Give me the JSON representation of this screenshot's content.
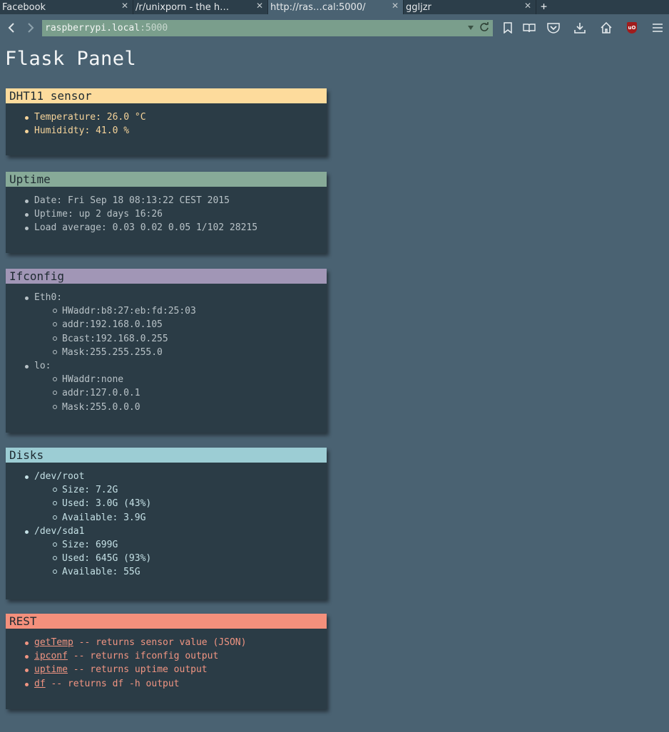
{
  "browser": {
    "tabs": [
      {
        "label": "Facebook",
        "active": false
      },
      {
        "label": "/r/unixporn - the h…",
        "active": false
      },
      {
        "label": "http://ras…cal:5000/",
        "active": true
      },
      {
        "label": "ggljzr",
        "active": false
      }
    ],
    "new_tab": "+",
    "url_host": "raspberrypi.local",
    "url_port": ":5000",
    "icons": [
      "back-icon",
      "forward-icon",
      "dropdown-icon",
      "reload-icon",
      "bookmark-icon",
      "reading-list-icon",
      "pocket-icon",
      "download-icon",
      "home-icon",
      "ublock-icon",
      "menu-icon"
    ],
    "ublock_label": "uO"
  },
  "page": {
    "title": "Flask Panel"
  },
  "panels": {
    "dht": {
      "title": "DHT11 sensor",
      "items": [
        "Temperature: 26.0 °C",
        "Humididty: 41.0 %"
      ]
    },
    "uptime": {
      "title": "Uptime",
      "items": [
        "Date: Fri Sep 18 08:13:22 CEST 2015",
        "Uptime: up 2 days 16:26",
        "Load average: 0.03 0.02 0.05 1/102 28215"
      ]
    },
    "ifconfig": {
      "title": "Ifconfig",
      "eth0": {
        "label": "Eth0:",
        "items": [
          "HWaddr:b8:27:eb:fd:25:03",
          "addr:192.168.0.105",
          "Bcast:192.168.0.255",
          "Mask:255.255.255.0"
        ]
      },
      "lo": {
        "label": "lo:",
        "items": [
          "HWaddr:none",
          "addr:127.0.0.1",
          "Mask:255.0.0.0"
        ]
      }
    },
    "disks": {
      "title": "Disks",
      "root": {
        "label": "/dev/root",
        "items": [
          "Size: 7.2G",
          "Used: 3.0G (43%)",
          "Available: 3.9G"
        ]
      },
      "sda1": {
        "label": "/dev/sda1",
        "items": [
          "Size: 699G",
          "Used: 645G (93%)",
          "Available: 55G"
        ]
      }
    },
    "rest": {
      "title": "REST",
      "items": [
        {
          "link": "getTemp",
          "text": " -- returns sensor value (JSON)"
        },
        {
          "link": "ipconf",
          "text": " -- returns ifconfig output"
        },
        {
          "link": "uptime",
          "text": " -- returns uptime output"
        },
        {
          "link": "df",
          "text": " -- returns df -h output"
        }
      ]
    }
  },
  "colors": {
    "background": "#4a6272",
    "panel_bg": "#2b3c46",
    "dht": "#fddb9c",
    "uptime": "#87aa98",
    "ifconfig": "#a196b6",
    "disks": "#9ccdd4",
    "rest": "#f4907c"
  }
}
